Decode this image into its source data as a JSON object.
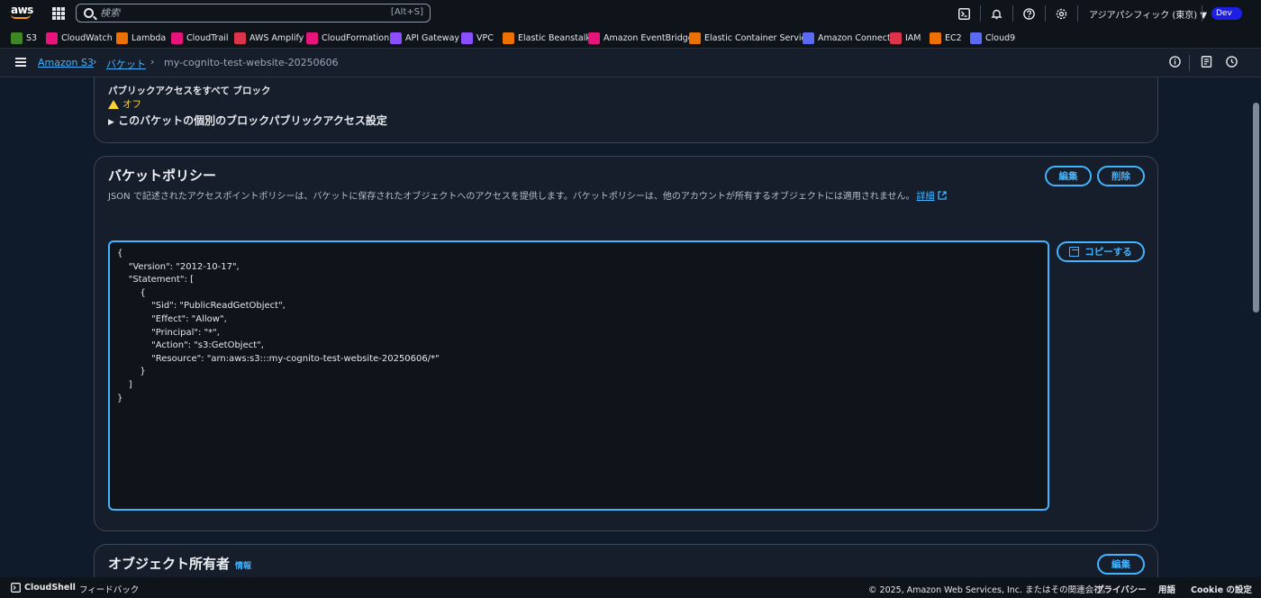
{
  "topnav": {
    "logo": "aws",
    "search_placeholder": "検索",
    "search_shortcut": "[Alt+S]",
    "region": "アジアパシフィック (東京) ▼",
    "account_badge": "Dev"
  },
  "favorites": [
    {
      "label": "S3",
      "color": "#3f8624"
    },
    {
      "label": "CloudWatch",
      "color": "#e7157b"
    },
    {
      "label": "Lambda",
      "color": "#ed7100"
    },
    {
      "label": "CloudTrail",
      "color": "#e7157b"
    },
    {
      "label": "AWS Amplify",
      "color": "#dd344c"
    },
    {
      "label": "CloudFormation",
      "color": "#e7157b"
    },
    {
      "label": "API Gateway",
      "color": "#8c4fff"
    },
    {
      "label": "VPC",
      "color": "#8c4fff"
    },
    {
      "label": "Elastic Beanstalk",
      "color": "#ed7100"
    },
    {
      "label": "Amazon EventBridge",
      "color": "#e7157b"
    },
    {
      "label": "Elastic Container Service",
      "color": "#ed7100"
    },
    {
      "label": "Amazon Connect",
      "color": "#5a6af5"
    },
    {
      "label": "IAM",
      "color": "#dd344c"
    },
    {
      "label": "EC2",
      "color": "#ed7100"
    },
    {
      "label": "Cloud9",
      "color": "#5a6af5"
    }
  ],
  "breadcrumb": {
    "service": "Amazon S3",
    "buckets": "バケット",
    "current": "my-cognito-test-website-20250606"
  },
  "block_public_access": {
    "label": "パブリックアクセスをすべて ブロック",
    "status": "オフ",
    "expand": "このバケットの個別のブロックパブリックアクセス設定"
  },
  "bucket_policy": {
    "title": "バケットポリシー",
    "description": "JSON で記述されたアクセスポイントポリシーは、バケットに保存されたオブジェクトへのアクセスを提供します。バケットポリシーは、他のアカウントが所有するオブジェクトには適用されません。",
    "details_link": "詳細",
    "edit_label": "編集",
    "delete_label": "削除",
    "copy_label": "コピーする",
    "policy_text": "{\n    \"Version\": \"2012-10-17\",\n    \"Statement\": [\n        {\n            \"Sid\": \"PublicReadGetObject\",\n            \"Effect\": \"Allow\",\n            \"Principal\": \"*\",\n            \"Action\": \"s3:GetObject\",\n            \"Resource\": \"arn:aws:s3:::my-cognito-test-website-20250606/*\"\n        }\n    ]\n}"
  },
  "object_ownership": {
    "title": "オブジェクト所有者",
    "info_link": "情報",
    "edit_label": "編集"
  },
  "footer": {
    "cloudshell": "CloudShell",
    "feedback": "フィードバック",
    "copyright": "© 2025, Amazon Web Services, Inc. またはその関連会社。",
    "privacy": "プライバシー",
    "terms": "用語",
    "cookie": "Cookie の設定"
  }
}
